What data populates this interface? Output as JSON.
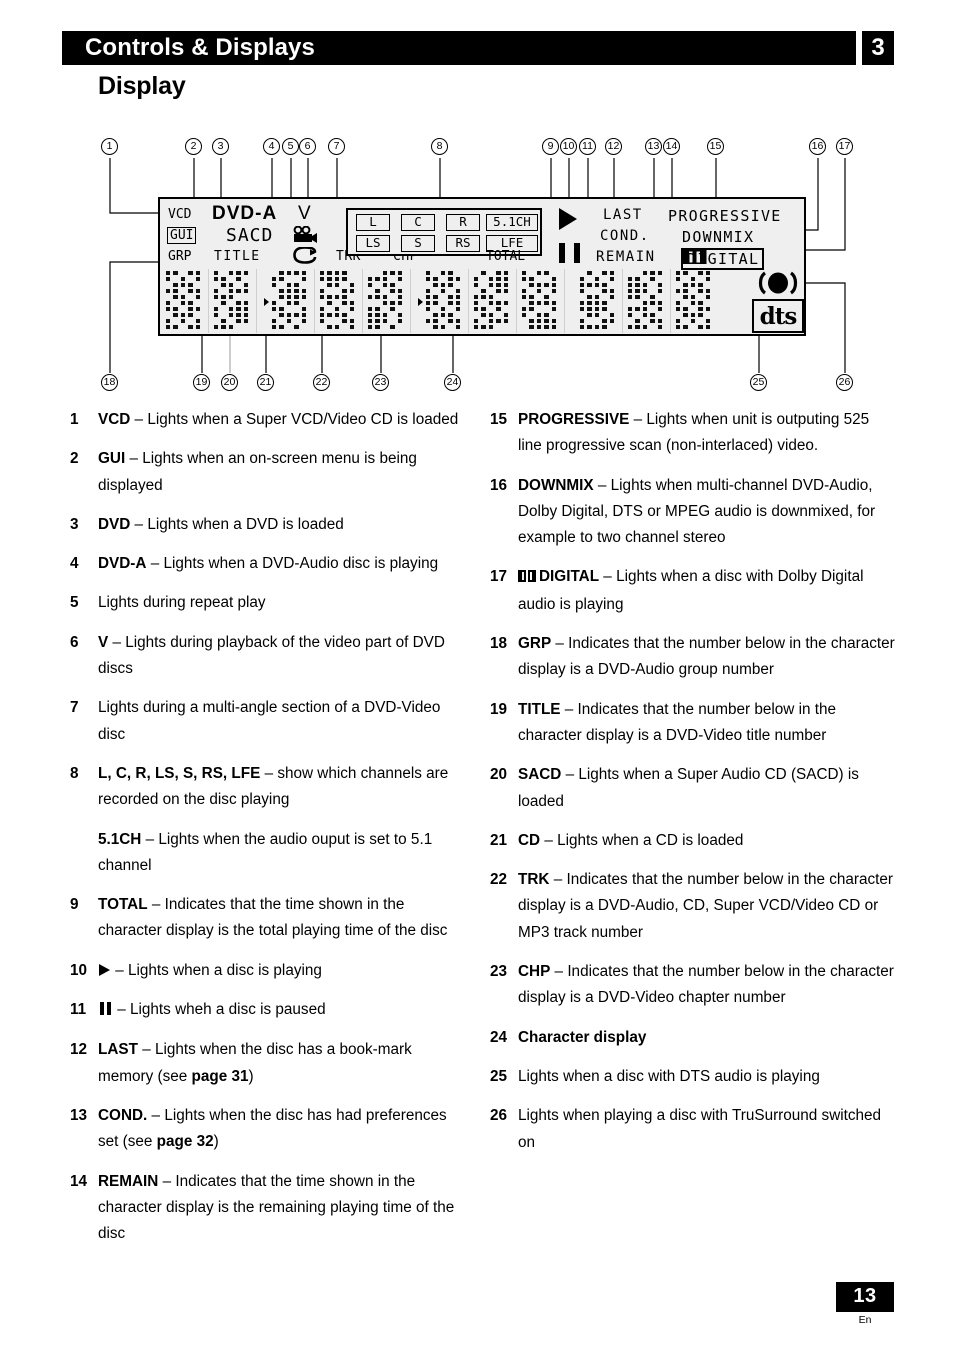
{
  "header": {
    "chapter_title": "Controls & Displays",
    "chapter_number": "3",
    "section_title": "Display"
  },
  "display_panel": {
    "indicators": {
      "vcd": "VCD",
      "gui": "GUI",
      "grp": "GRP",
      "dvd_a": "DVD-A",
      "sacd": "SACD",
      "title": "TITLE",
      "v": "V",
      "angle_icon": "video-camera-icon",
      "repeat_icon": "repeat-loop-icon",
      "trk": "TRK",
      "chp": "CHP",
      "total": "TOTAL",
      "play_icon": "play-triangle-icon",
      "pause_icon": "pause-bars-icon",
      "last": "LAST",
      "cond": "COND.",
      "remain": "REMAIN",
      "progressive": "PROGRESSIVE",
      "downmix": "DOWNMIX",
      "dolby_digital": "DIGITAL",
      "dolby_icon": "dolby-double-d-icon",
      "trusurround_icon": "trusurround-icon",
      "dts": "dts"
    },
    "channels": [
      {
        "label": "L"
      },
      {
        "label": "C"
      },
      {
        "label": "R"
      },
      {
        "label": "5.1CH"
      },
      {
        "label": "LS"
      },
      {
        "label": "S"
      },
      {
        "label": "RS"
      },
      {
        "label": "LFE"
      }
    ],
    "callouts": [
      "1",
      "2",
      "3",
      "4",
      "5",
      "6",
      "7",
      "8",
      "9",
      "10",
      "11",
      "12",
      "13",
      "14",
      "15",
      "16",
      "17",
      "18",
      "19",
      "20",
      "21",
      "22",
      "23",
      "24",
      "25",
      "26"
    ]
  },
  "left_column": [
    {
      "index": "1",
      "term": "VCD",
      "dash": " – ",
      "text": "Lights when a Super VCD/Video CD is loaded"
    },
    {
      "index": "2",
      "term": "GUI",
      "dash": " – ",
      "text": "Lights when an on-screen menu is being displayed"
    },
    {
      "index": "3",
      "term": "DVD",
      "dash": " – ",
      "text": "Lights when a DVD is loaded"
    },
    {
      "index": "4",
      "term": "DVD-A",
      "dash": " – ",
      "text": "Lights when a DVD-Audio disc is playing"
    },
    {
      "index": "5",
      "term": "",
      "dash": "",
      "text": "Lights during repeat play"
    },
    {
      "index": "6",
      "term": "V",
      "dash": " – ",
      "text": "Lights during playback of the video part of DVD discs"
    },
    {
      "index": "7",
      "term": "",
      "dash": "",
      "text": "Lights during a multi-angle section of a DVD-Video disc"
    },
    {
      "index": "8",
      "term": "L, C, R, LS, S, RS, LFE",
      "dash": " – ",
      "text": "show which channels are recorded on the disc playing",
      "sub_term": "5.1CH",
      "sub_dash": " – ",
      "sub_text": "Lights when the audio ouput is set to 5.1 channel"
    },
    {
      "index": "9",
      "term": "TOTAL",
      "dash": " – ",
      "text": "Indicates that the time shown in the character display is the total playing time of the disc"
    },
    {
      "index": "10",
      "term": "",
      "dash": " – ",
      "text": "Lights when a disc is playing",
      "icon": "play-triangle-icon"
    },
    {
      "index": "11",
      "term": "",
      "dash": " – ",
      "text": "Lights wheh a disc is paused",
      "icon": "pause-bars-icon"
    },
    {
      "index": "12",
      "term": "LAST",
      "dash": " – ",
      "text": "Lights when the disc has a book-mark memory (see ",
      "ref": "page 31",
      "text_after": ")"
    },
    {
      "index": "13",
      "term": "COND.",
      "dash": " – ",
      "text": "Lights when the disc has had preferences set (see ",
      "ref": "page 32",
      "text_after": ")"
    },
    {
      "index": "14",
      "term": "REMAIN",
      "dash": " – ",
      "text": "Indicates that the time shown in the character display is the remaining playing time of the disc"
    }
  ],
  "right_column": [
    {
      "index": "15",
      "term": "PROGRESSIVE",
      "dash": " – ",
      "text": "Lights when unit is outputing 525 line progressive scan (non-interlaced) video."
    },
    {
      "index": "16",
      "term": "DOWNMIX",
      "dash": " – ",
      "text": "Lights when multi-channel DVD-Audio, Dolby Digital, DTS or MPEG audio is downmixed, for example to two channel stereo"
    },
    {
      "index": "17",
      "term": "DIGITAL",
      "dash": " – ",
      "text": "Lights when a disc with Dolby Digital audio is playing",
      "icon": "dolby-double-d-icon"
    },
    {
      "index": "18",
      "term": "GRP",
      "dash": " – ",
      "text": "Indicates that the number below in the character display is a DVD-Audio group number"
    },
    {
      "index": "19",
      "term": "TITLE",
      "dash": " – ",
      "text": "Indicates that the number below in the character display is a DVD-Video title number"
    },
    {
      "index": "20",
      "term": "SACD",
      "dash": " – ",
      "text": "Lights when a Super Audio CD (SACD) is loaded"
    },
    {
      "index": "21",
      "term": "CD",
      "dash": " – ",
      "text": "Lights when a CD is loaded"
    },
    {
      "index": "22",
      "term": "TRK",
      "dash": " – ",
      "text": "Indicates that the number below in the character display is a DVD-Audio, CD, Super VCD/Video CD or MP3 track number"
    },
    {
      "index": "23",
      "term": "CHP",
      "dash": " – ",
      "text": "Indicates that the number below in the character display is a DVD-Video chapter number"
    },
    {
      "index": "24",
      "term": "Character display",
      "dash": "",
      "text": ""
    },
    {
      "index": "25",
      "term": "",
      "dash": "",
      "text": "Lights when a disc with DTS audio is playing"
    },
    {
      "index": "26",
      "term": "",
      "dash": "",
      "text": "Lights when playing a disc with TruSurround switched on"
    }
  ],
  "footer": {
    "page_number": "13",
    "language": "En"
  }
}
